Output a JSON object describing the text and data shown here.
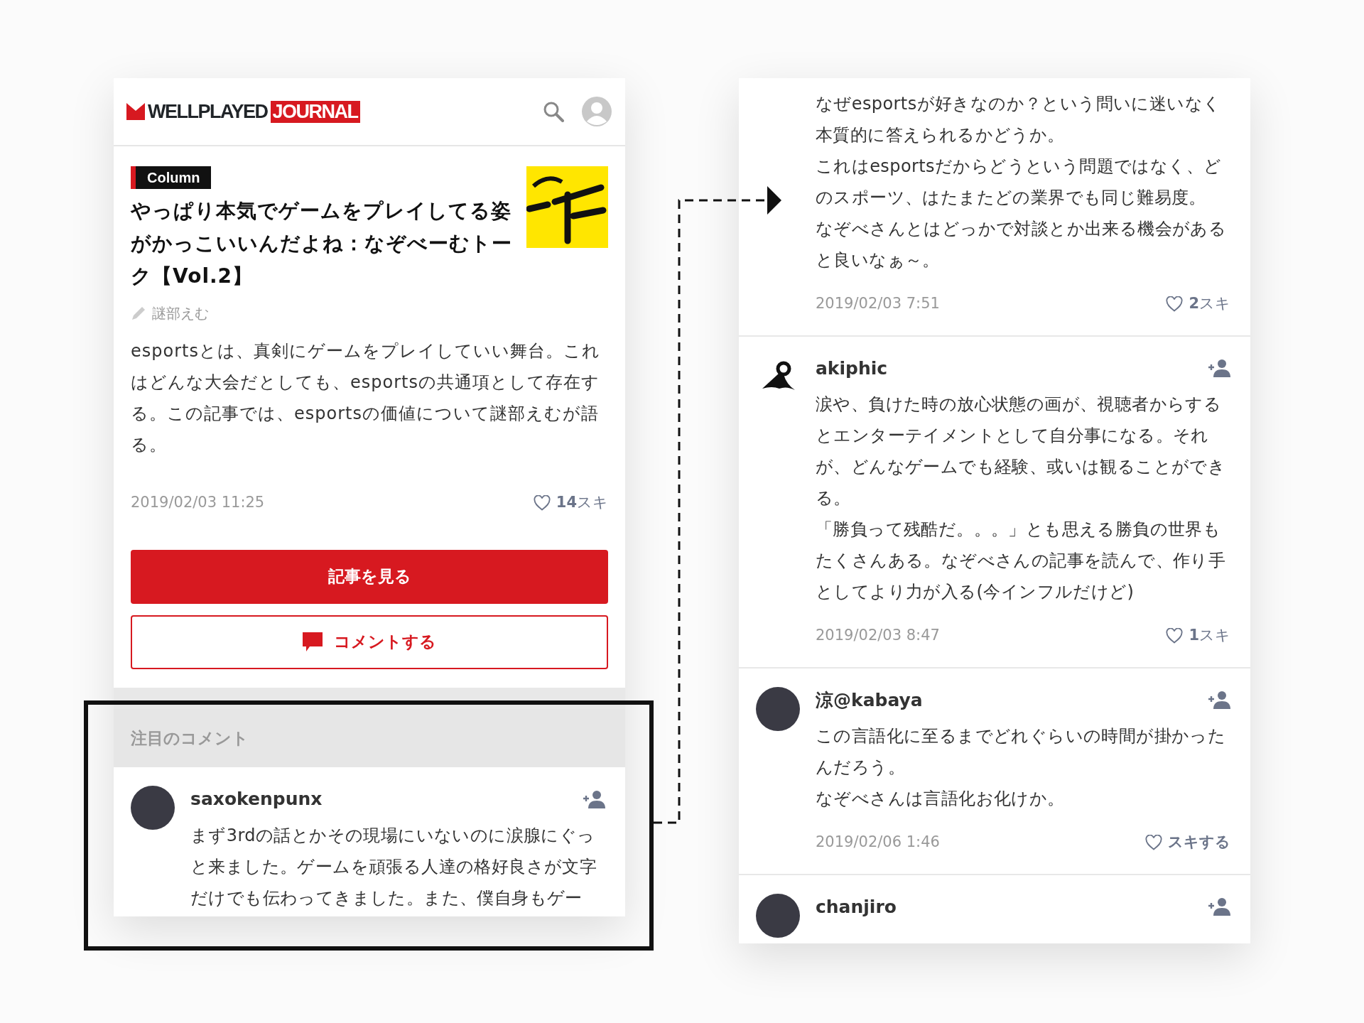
{
  "left_screen": {
    "header": {
      "logo_main": "WELLPLAYED",
      "logo_accent": "JOURNAL"
    },
    "article": {
      "category": "Column",
      "title": "やっぱり本気でゲームをプレイしてる姿がかっこいいんだよね：なぞべーむトーク【Vol.2】",
      "author": "謎部えむ",
      "summary": "esportsとは、真剣にゲームをプレイしていい舞台。これはどんな大会だとしても、esportsの共通項として存在する。この記事では、esportsの価値について謎部えむが語る。",
      "date": "2019/02/03 11:25",
      "likes": {
        "count": "14",
        "label": "スキ"
      }
    },
    "buttons": [
      {
        "label": "記事を見る",
        "kind": "primary"
      },
      {
        "label": "コメントする",
        "kind": "outline"
      }
    ],
    "featured": {
      "heading": "注目のコメント",
      "comments": [
        {
          "author": "saxokenpunx",
          "avatar": {
            "kind": "photo"
          },
          "text": [
            "まず3rdの話とかその現場にいないのに涙腺にぐっと来ました。ゲームを頑張る人達の格好良さが文字だけでも伝わってきました。また、僕自身もゲー"
          ]
        }
      ]
    }
  },
  "right_screen": {
    "comments": [
      {
        "text": [
          "なぜesportsが好きなのか？という問いに迷いなく本質的に答えられるかどうか。",
          "これはesportsだからどうという問題ではなく、どのスポーツ、はたまたどの業界でも同じ難易度。",
          "なぞべさんとはどっかで対談とか出来る機会があると良いなぁ～。"
        ],
        "date": "2019/02/03 7:51",
        "likes": {
          "count": "2",
          "label": "スキ"
        }
      },
      {
        "author": "akiphic",
        "avatar": {
          "kind": "logo"
        },
        "text": [
          "涙や、負けた時の放心状態の画が、視聴者からするとエンターテイメントとして自分事になる。それが、どんなゲームでも経験、或いは観ることができる。",
          "「勝負って残酷だ。。。」とも思える勝負の世界もたくさんある。なぞべさんの記事を読んで、作り手としてより力が入る(今インフルだけど)"
        ],
        "date": "2019/02/03 8:47",
        "likes": {
          "count": "1",
          "label": "スキ"
        }
      },
      {
        "author": "涼@kabaya",
        "avatar": {
          "kind": "photo"
        },
        "text": [
          "この言語化に至るまでどれぐらいの時間が掛かったんだろう。",
          "なぞべさんは言語化お化けか。"
        ],
        "date": "2019/02/06 1:46",
        "likes": {
          "label": "スキする"
        }
      },
      {
        "author": "chanjiro",
        "avatar": {
          "kind": "photo"
        }
      }
    ]
  }
}
